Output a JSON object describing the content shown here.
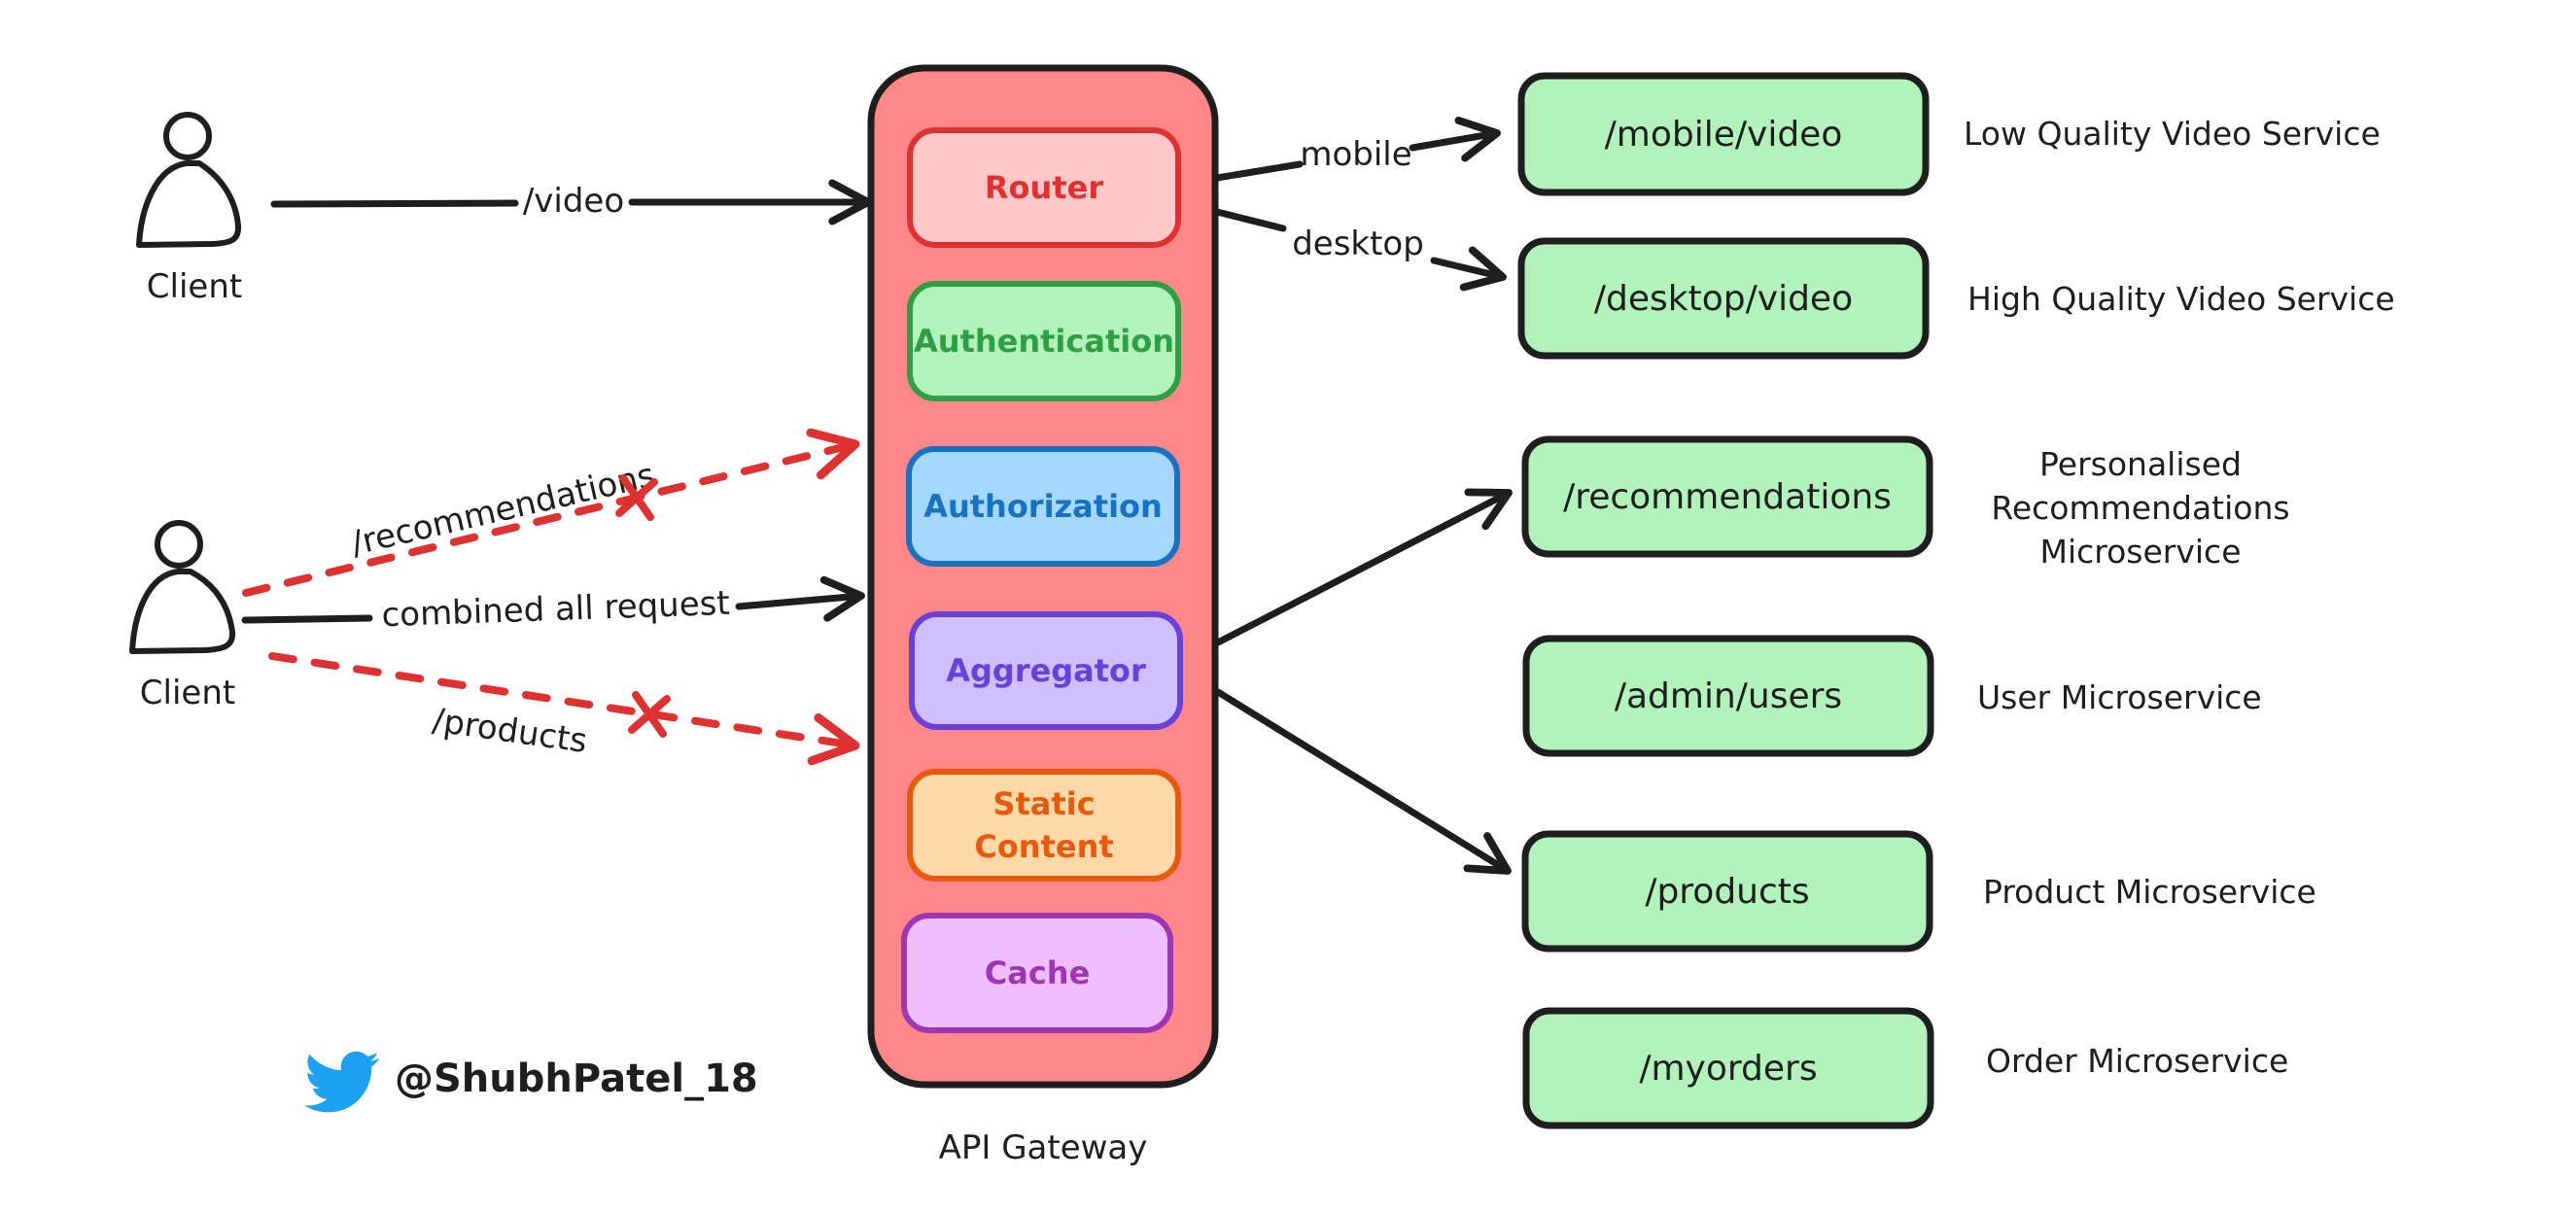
{
  "diagram_title": "API Gateway",
  "clients": [
    {
      "label": "Client",
      "request_label": "/video"
    },
    {
      "label": "Client",
      "request_label": "combined all request",
      "blocked_requests": [
        "/recommendations",
        "/products"
      ]
    }
  ],
  "gateway": {
    "label": "API Gateway",
    "fill": "#ff8787",
    "components": [
      {
        "label": "Router",
        "text_color": "#e03131",
        "fill": "#ffc9c9",
        "stroke": "#e03131"
      },
      {
        "label": "Authentication",
        "text_color": "#2f9e44",
        "fill": "#b2f2bb",
        "stroke": "#2f9e44"
      },
      {
        "label": "Authorization",
        "text_color": "#1971c2",
        "fill": "#a5d8ff",
        "stroke": "#1971c2"
      },
      {
        "label": "Aggregator",
        "text_color": "#6741d9",
        "fill": "#d0bfff",
        "stroke": "#6741d9"
      },
      {
        "label": "Static\nContent",
        "text_color": "#e8590c",
        "fill": "#ffd8a8",
        "stroke": "#e8590c"
      },
      {
        "label": "Cache",
        "text_color": "#9c36b5",
        "fill": "#eebefa",
        "stroke": "#9c36b5"
      }
    ]
  },
  "router_routes": [
    {
      "label": "mobile",
      "target": "/mobile/video"
    },
    {
      "label": "desktop",
      "target": "/desktop/video"
    }
  ],
  "services": [
    {
      "path": "/mobile/video",
      "description": "Low Quality Video Service"
    },
    {
      "path": "/desktop/video",
      "description": "High Quality Video Service"
    },
    {
      "path": "/recommendations",
      "description": "Personalised\nRecommendations\nMicroservice"
    },
    {
      "path": "/admin/users",
      "description": "User Microservice"
    },
    {
      "path": "/products",
      "description": "Product Microservice"
    },
    {
      "path": "/myorders",
      "description": "Order Microservice"
    }
  ],
  "service_fill": "#b2f2bb",
  "blocked_color": "#e03131",
  "stroke_color": "#1e1e1e",
  "credit": {
    "icon": "twitter-bird-icon",
    "handle": "@ShubhPatel_18",
    "icon_color": "#1da1f2"
  }
}
